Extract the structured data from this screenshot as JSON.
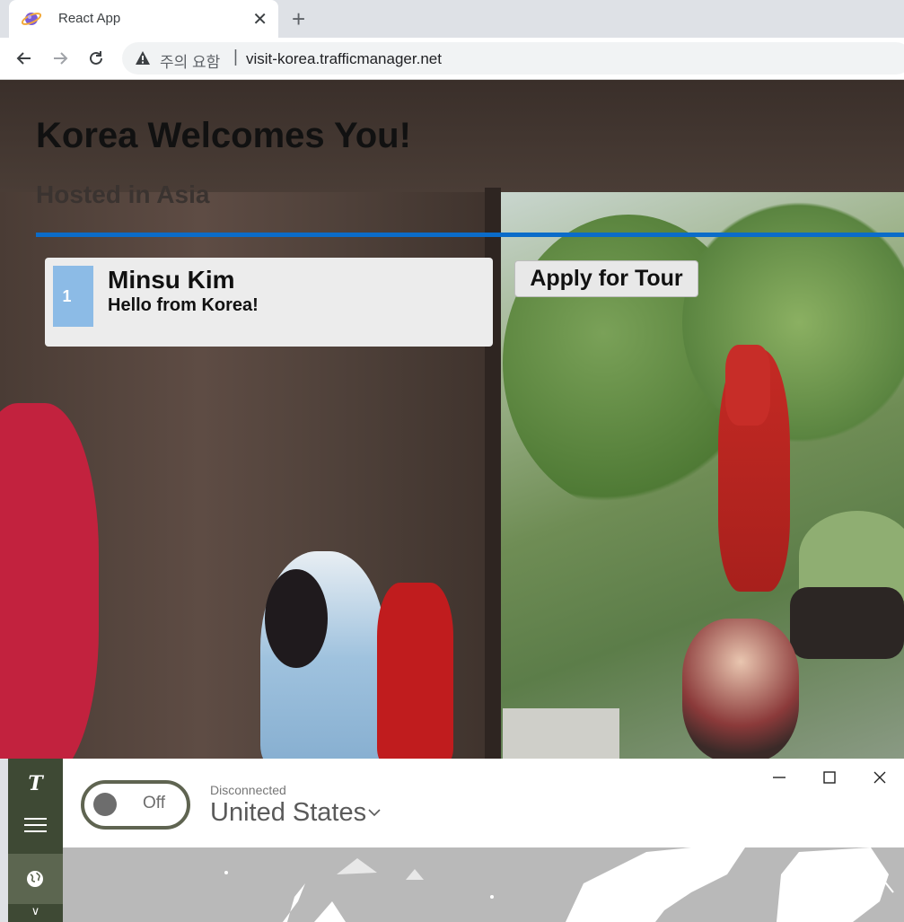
{
  "browser": {
    "tab_title": "React App",
    "tab_close_glyph": "✕",
    "new_tab_glyph": "+",
    "security_label": "주의 요함",
    "separator": "|",
    "url": "visit-korea.trafficmanager.net",
    "icons": [
      "app-favicon",
      "back-icon",
      "forward-icon",
      "reload-icon",
      "warning-icon"
    ]
  },
  "page": {
    "title": "Korea Welcomes You!",
    "subtitle": "Hosted in Asia",
    "accent_color": "#0b6cc9",
    "card": {
      "index": "1",
      "name": "Minsu Kim",
      "message": "Hello from Korea!"
    },
    "apply_button": "Apply for Tour"
  },
  "vpn": {
    "logo": "T",
    "toggle_label": "Off",
    "status": "Disconnected",
    "country": "United States",
    "icons": [
      "logo-icon",
      "menu-icon",
      "globe-icon",
      "chevron-down-icon",
      "minimize-icon",
      "maximize-icon",
      "close-icon"
    ],
    "accent_color": "#3e4934"
  }
}
